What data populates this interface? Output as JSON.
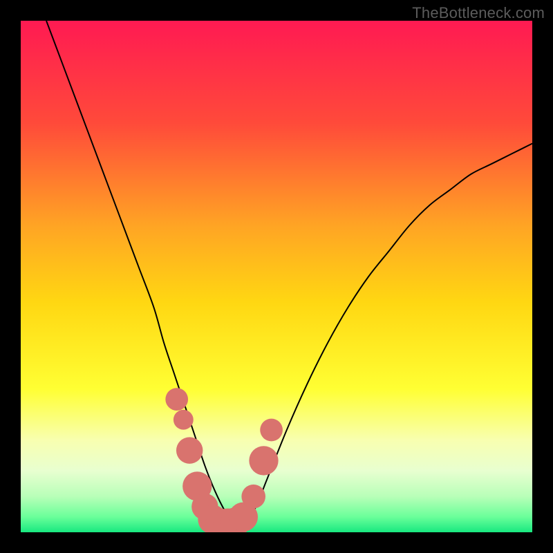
{
  "watermark": "TheBottleneck.com",
  "chart_data": {
    "type": "line",
    "title": "",
    "xlabel": "",
    "ylabel": "",
    "xlim": [
      0,
      100
    ],
    "ylim": [
      0,
      100
    ],
    "legend": false,
    "grid": false,
    "background_gradient": {
      "stops": [
        {
          "offset": 0.0,
          "color": "#ff1a52"
        },
        {
          "offset": 0.2,
          "color": "#ff4a3a"
        },
        {
          "offset": 0.4,
          "color": "#ffa424"
        },
        {
          "offset": 0.55,
          "color": "#ffd712"
        },
        {
          "offset": 0.72,
          "color": "#ffff33"
        },
        {
          "offset": 0.82,
          "color": "#f8ffb0"
        },
        {
          "offset": 0.88,
          "color": "#e8ffd0"
        },
        {
          "offset": 0.93,
          "color": "#b8ffb8"
        },
        {
          "offset": 0.97,
          "color": "#6aff9a"
        },
        {
          "offset": 1.0,
          "color": "#18e880"
        }
      ]
    },
    "series": [
      {
        "name": "bottleneck-curve",
        "x": [
          5,
          8,
          11,
          14,
          17,
          20,
          23,
          26,
          28,
          30,
          32,
          34,
          36,
          38,
          40,
          42,
          44,
          46,
          48,
          52,
          56,
          60,
          64,
          68,
          72,
          76,
          80,
          84,
          88,
          92,
          96,
          100
        ],
        "y": [
          100,
          92,
          84,
          76,
          68,
          60,
          52,
          44,
          37,
          31,
          25,
          19,
          13,
          8,
          4,
          1,
          2,
          5,
          10,
          20,
          29,
          37,
          44,
          50,
          55,
          60,
          64,
          67,
          70,
          72,
          74,
          76
        ]
      }
    ],
    "markers": {
      "name": "highlight-dots",
      "color": "#d9736e",
      "points": [
        {
          "x": 30.5,
          "y": 26,
          "r": 1.7
        },
        {
          "x": 31.8,
          "y": 22,
          "r": 1.5
        },
        {
          "x": 33.0,
          "y": 16,
          "r": 2.0
        },
        {
          "x": 34.5,
          "y": 9,
          "r": 2.2
        },
        {
          "x": 36.0,
          "y": 5,
          "r": 2.0
        },
        {
          "x": 37.5,
          "y": 2.5,
          "r": 2.2
        },
        {
          "x": 39.0,
          "y": 1.8,
          "r": 2.2
        },
        {
          "x": 40.5,
          "y": 1.8,
          "r": 2.2
        },
        {
          "x": 42.0,
          "y": 2.0,
          "r": 2.2
        },
        {
          "x": 43.5,
          "y": 3.0,
          "r": 2.2
        },
        {
          "x": 45.5,
          "y": 7,
          "r": 1.8
        },
        {
          "x": 47.5,
          "y": 14,
          "r": 2.2
        },
        {
          "x": 49.0,
          "y": 20,
          "r": 1.7
        }
      ]
    }
  }
}
